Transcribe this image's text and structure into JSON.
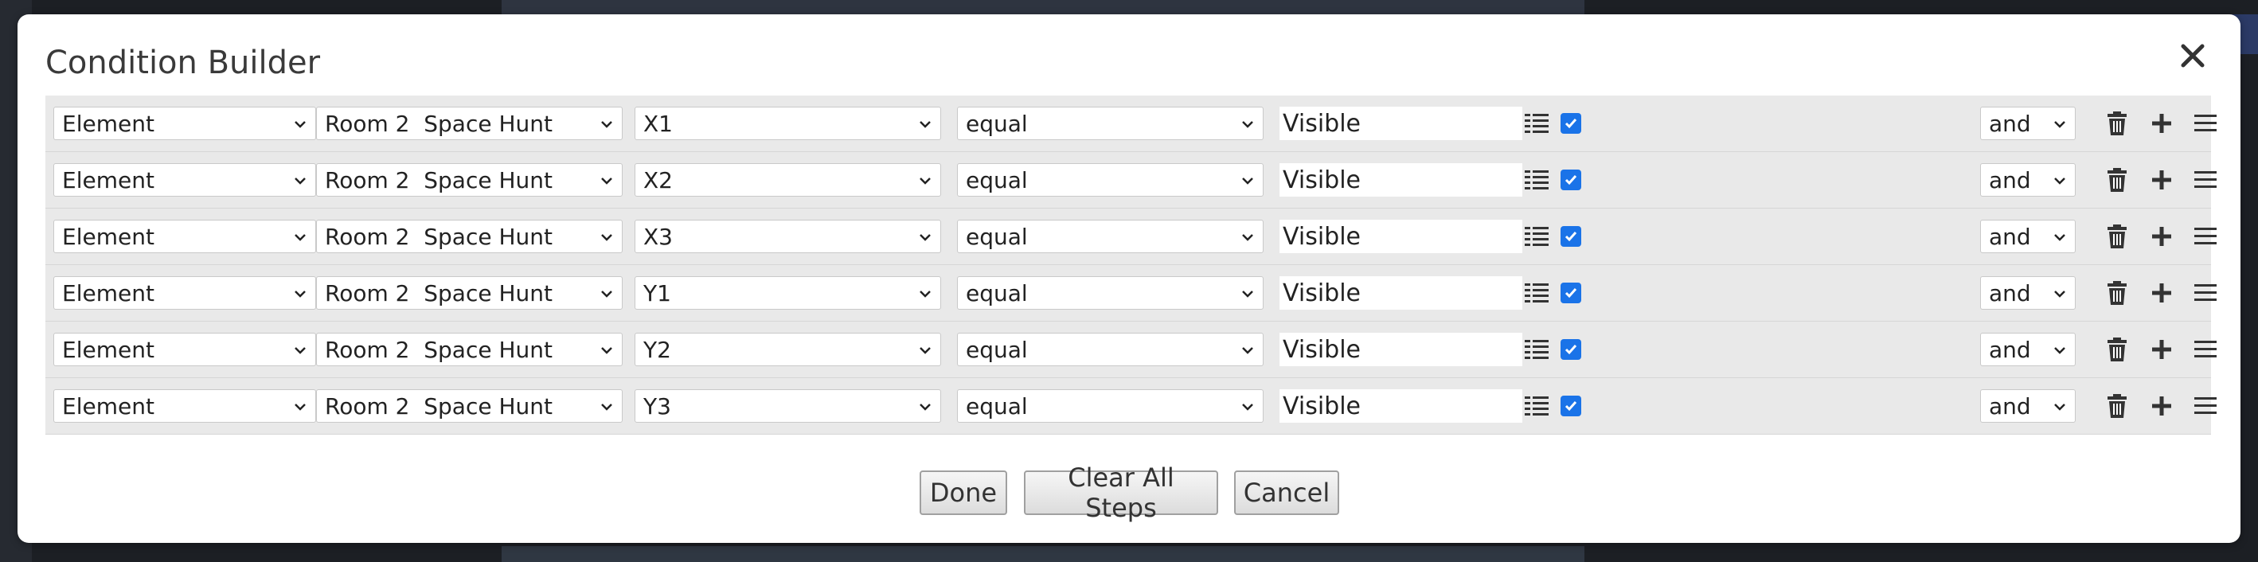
{
  "dialog": {
    "title": "Condition Builder"
  },
  "rows": [
    {
      "type": "Element",
      "room": "Room 2  Space Hunt",
      "element": "X1",
      "operator": "equal",
      "value": "Visible",
      "enabled": true,
      "connector": "and"
    },
    {
      "type": "Element",
      "room": "Room 2  Space Hunt",
      "element": "X2",
      "operator": "equal",
      "value": "Visible",
      "enabled": true,
      "connector": "and"
    },
    {
      "type": "Element",
      "room": "Room 2  Space Hunt",
      "element": "X3",
      "operator": "equal",
      "value": "Visible",
      "enabled": true,
      "connector": "and"
    },
    {
      "type": "Element",
      "room": "Room 2  Space Hunt",
      "element": "Y1",
      "operator": "equal",
      "value": "Visible",
      "enabled": true,
      "connector": "and"
    },
    {
      "type": "Element",
      "room": "Room 2  Space Hunt",
      "element": "Y2",
      "operator": "equal",
      "value": "Visible",
      "enabled": true,
      "connector": "and"
    },
    {
      "type": "Element",
      "room": "Room 2  Space Hunt",
      "element": "Y3",
      "operator": "equal",
      "value": "Visible",
      "enabled": true,
      "connector": "and"
    }
  ],
  "icons": {
    "close": "close-icon",
    "value_list": "list-icon",
    "delete": "trash-icon",
    "add": "plus-icon",
    "reorder": "menu-icon",
    "dropdown": "chevron-down-icon"
  },
  "footer": {
    "done": "Done",
    "clear": "Clear All Steps",
    "cancel": "Cancel"
  },
  "colors": {
    "checkbox": "#1a73e8",
    "row_bg": "#e9e9e9",
    "overlay": "#1c1f24"
  }
}
